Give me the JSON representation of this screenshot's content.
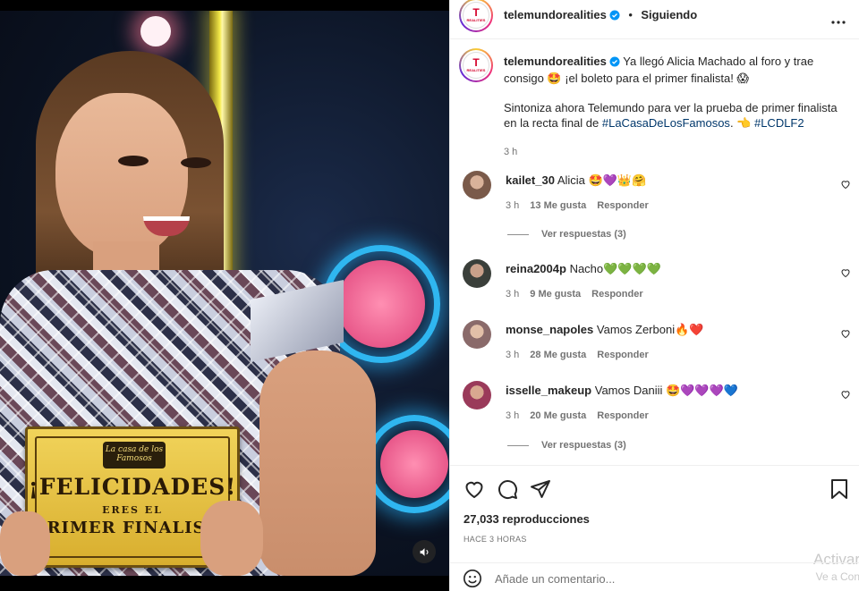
{
  "media": {
    "sign_line1": "¡FELICIDADES!",
    "sign_line2": "ERES EL",
    "sign_line3": "PRIMER FINALISTA",
    "sign_logo": "La casa de los Famosos"
  },
  "post": {
    "username": "telemundorealities",
    "follow_status": "Siguiendo",
    "avatar_text": "T",
    "avatar_subtext": "REALITIES",
    "caption_text_1": "Ya llegó Alicia Machado al foro y trae consigo 🤩 ¡el boleto para el primer finalista! 😱",
    "caption_text_2a": "Sintoniza ahora Telemundo para ver la prueba de primer finalista en la recta final de ",
    "caption_hashtag_1": "#LaCasaDeLosFamosos",
    "caption_text_2b": ". 👈 ",
    "caption_hashtag_2": "#LCDLF2",
    "time": "3 h"
  },
  "comments": [
    {
      "username": "kailet_30",
      "text": "Alicia 🤩💜👑🤗",
      "time": "3 h",
      "likes": "13 Me gusta",
      "reply": "Responder",
      "view_replies": "Ver respuestas (3)",
      "avatar_color": "#7a5a4a"
    },
    {
      "username": "reina2004p",
      "text": "Nacho💚💚💚💚",
      "time": "3 h",
      "likes": "9 Me gusta",
      "reply": "Responder",
      "view_replies": "",
      "avatar_color": "#3a3f3a"
    },
    {
      "username": "monse_napoles",
      "text": "Vamos Zerboni🔥❤️",
      "time": "3 h",
      "likes": "28 Me gusta",
      "reply": "Responder",
      "view_replies": "",
      "avatar_color": "#8a6a6a"
    },
    {
      "username": "isselle_makeup",
      "text": "Vamos Daniii 🤩💜💜💜💙",
      "time": "3 h",
      "likes": "20 Me gusta",
      "reply": "Responder",
      "view_replies": "Ver respuestas (3)",
      "avatar_color": "#9a3a5a"
    }
  ],
  "stats": {
    "views": "27,033 reproducciones",
    "posted_ago": "HACE 3 HORAS"
  },
  "add_comment": {
    "placeholder": "Añade un comentario..."
  },
  "watermark": {
    "line1": "Activar",
    "line2": "Ve a Con"
  },
  "icons": {
    "verified": "verified-badge-icon",
    "more": "more-options-icon",
    "heart": "heart-icon",
    "comment": "comment-icon",
    "share": "share-icon",
    "save": "bookmark-icon",
    "emoji": "emoji-icon",
    "sound": "speaker-icon"
  },
  "colors": {
    "verified": "#0095f6",
    "link": "#00376b",
    "secondary_text": "#737373"
  }
}
